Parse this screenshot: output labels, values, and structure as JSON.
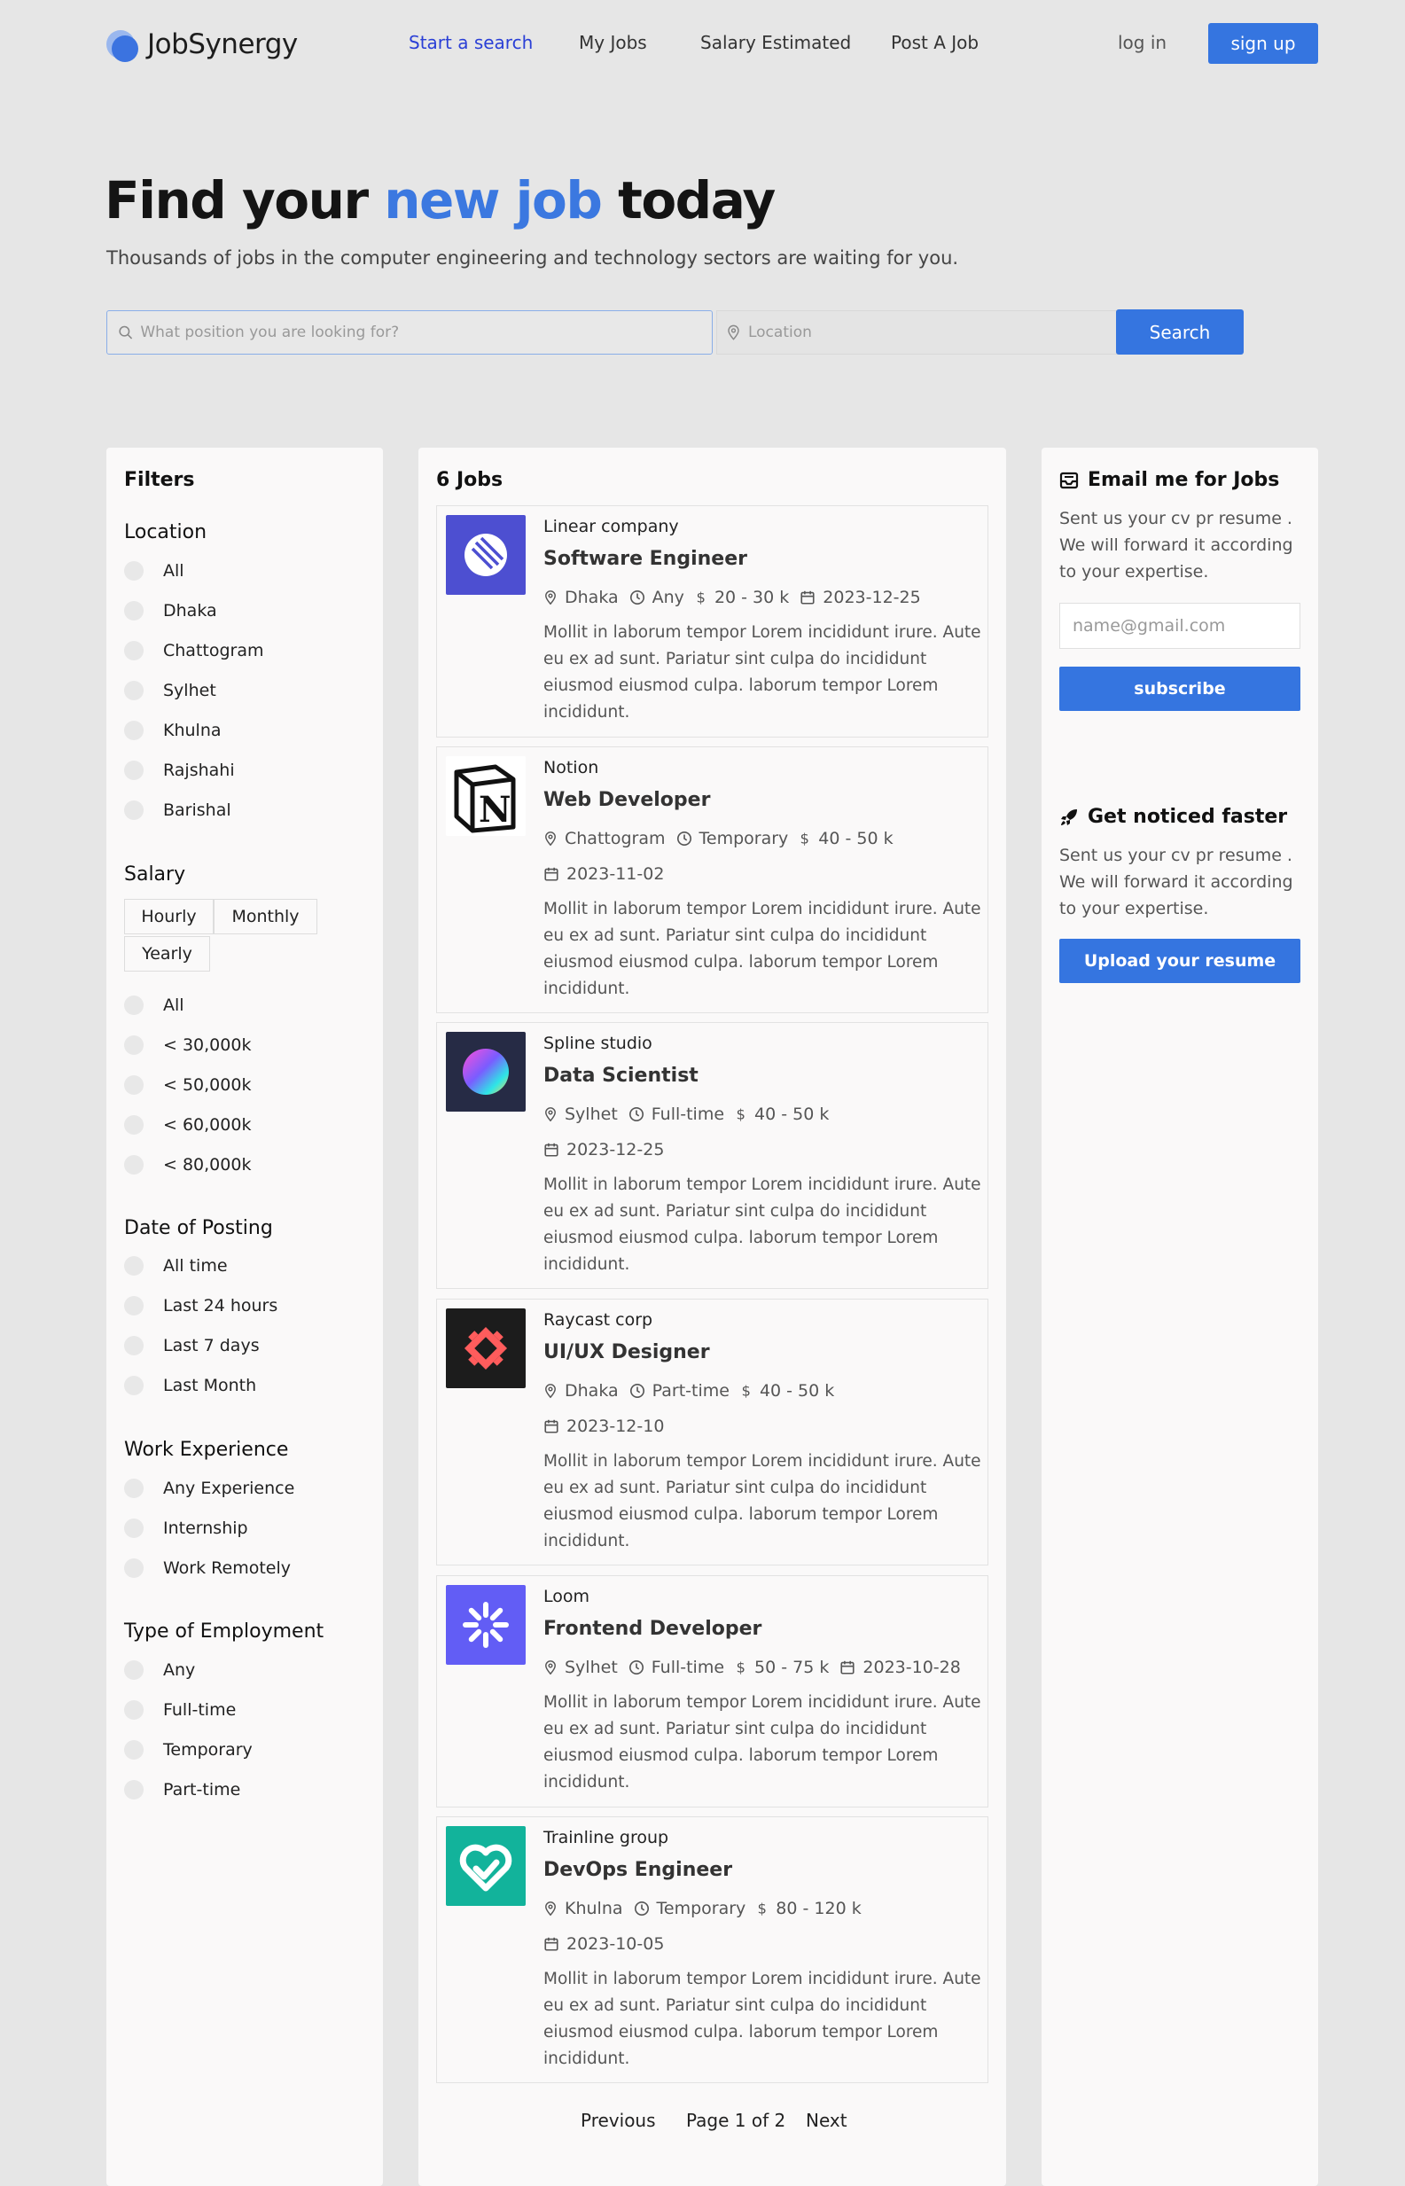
{
  "brand": {
    "name": "JobSynergy"
  },
  "nav": {
    "links": [
      "Start a search",
      "My Jobs",
      "Salary Estimated",
      "Post A Job"
    ],
    "login": "log in",
    "signup": "sign up"
  },
  "hero": {
    "title_pre": "Find your ",
    "title_accent": "new job",
    "title_post": " today",
    "subtitle": "Thousands of jobs in the computer engineering and technology sectors are waiting for you.",
    "search_placeholder": "What position you are looking for?",
    "location_placeholder": "Location",
    "search_button": "Search"
  },
  "filters": {
    "title": "Filters",
    "location": {
      "title": "Location",
      "options": [
        "All",
        "Dhaka",
        "Chattogram",
        "Sylhet",
        "Khulna",
        "Rajshahi",
        "Barishal"
      ]
    },
    "salary": {
      "title": "Salary",
      "periods": [
        "Hourly",
        "Monthly",
        "Yearly"
      ],
      "options": [
        "All",
        "< 30,000k",
        "< 50,000k",
        "< 60,000k",
        "< 80,000k"
      ]
    },
    "date": {
      "title": "Date of Posting",
      "options": [
        "All time",
        "Last 24 hours",
        "Last 7 days",
        "Last Month"
      ]
    },
    "experience": {
      "title": "Work Experience",
      "options": [
        "Any Experience",
        "Internship",
        "Work Remotely"
      ]
    },
    "employment": {
      "title": "Type of Employment",
      "options": [
        "Any",
        "Full-time",
        "Temporary",
        "Part-time"
      ]
    }
  },
  "jobs": {
    "count": "6 Jobs",
    "items": [
      {
        "company": "Linear company",
        "title": "Software Engineer",
        "location": "Dhaka",
        "type": "Any",
        "salary": "20 - 30 k",
        "date": "2023-12-25",
        "desc": "Mollit in laborum tempor Lorem incididunt irure. Aute eu ex ad sunt. Pariatur sint culpa do incididunt eiusmod eiusmod culpa. laborum tempor Lorem incididunt.",
        "logo": "linear",
        "color": "#4d4fd1"
      },
      {
        "company": "Notion",
        "title": "Web Developer",
        "location": "Chattogram",
        "type": "Temporary",
        "salary": "40 - 50 k",
        "date": "2023-11-02",
        "desc": "Mollit in laborum tempor Lorem incididunt irure. Aute eu ex ad sunt. Pariatur sint culpa do incididunt eiusmod eiusmod culpa. laborum tempor Lorem incididunt.",
        "logo": "notion",
        "color": "#ffffff"
      },
      {
        "company": "Spline studio",
        "title": "Data Scientist",
        "location": "Sylhet",
        "type": "Full-time",
        "salary": "40 - 50 k",
        "date": "2023-12-25",
        "desc": "Mollit in laborum tempor Lorem incididunt irure. Aute eu ex ad sunt. Pariatur sint culpa do incididunt eiusmod eiusmod culpa. laborum tempor Lorem incididunt.",
        "logo": "spline",
        "color": "#262b45"
      },
      {
        "company": "Raycast corp",
        "title": "UI/UX Designer",
        "location": "Dhaka",
        "type": "Part-time",
        "salary": "40 - 50 k",
        "date": "2023-12-10",
        "desc": "Mollit in laborum tempor Lorem incididunt irure. Aute eu ex ad sunt. Pariatur sint culpa do incididunt eiusmod eiusmod culpa. laborum tempor Lorem incididunt.",
        "logo": "raycast",
        "color": "#1c1c1c"
      },
      {
        "company": "Loom",
        "title": "Frontend Developer",
        "location": "Sylhet",
        "type": "Full-time",
        "salary": "50 - 75 k",
        "date": "2023-10-28",
        "desc": "Mollit in laborum tempor Lorem incididunt irure. Aute eu ex ad sunt. Pariatur sint culpa do incididunt eiusmod eiusmod culpa. laborum tempor Lorem incididunt.",
        "logo": "loom",
        "color": "#625df5"
      },
      {
        "company": "Trainline group",
        "title": "DevOps Engineer",
        "location": "Khulna",
        "type": "Temporary",
        "salary": "80 - 120 k",
        "date": "2023-10-05",
        "desc": "Mollit in laborum tempor Lorem incididunt irure. Aute eu ex ad sunt. Pariatur sint culpa do incididunt eiusmod eiusmod culpa. laborum tempor Lorem incididunt.",
        "logo": "trainline",
        "color": "#12b39b"
      }
    ]
  },
  "pagination": {
    "previous": "Previous",
    "page": "Page 1 of 2",
    "next": "Next"
  },
  "sidebar": {
    "email": {
      "title": "Email me for Jobs",
      "text": "Sent us your cv pr resume . We will forward it according to your expertise.",
      "placeholder": "name@gmail.com",
      "button": "subscribe"
    },
    "noticed": {
      "title": "Get noticed faster",
      "text": "Sent us your cv pr resume . We will forward it according to your expertise.",
      "button": "Upload your resume"
    }
  },
  "colors": {
    "accent": "#3575e0",
    "nav_active": "#2a3fd6",
    "background": "#e6e6e6"
  }
}
